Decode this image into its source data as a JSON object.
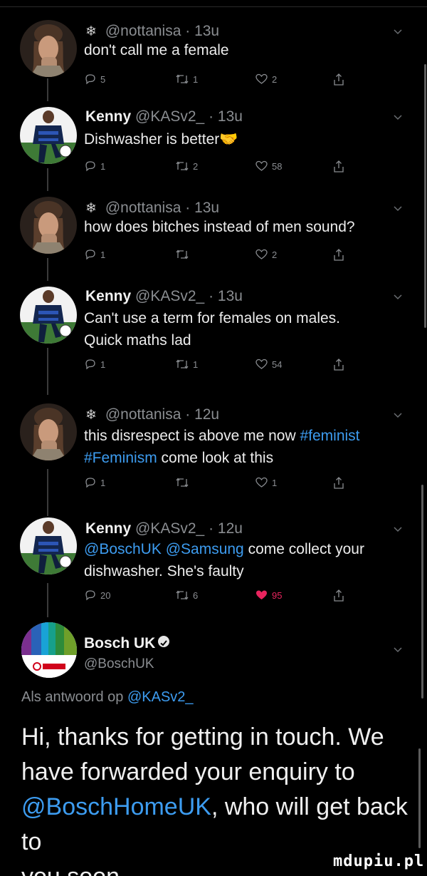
{
  "tweets": [
    {
      "user": "nottanisa",
      "name": "",
      "handle": "@nottanisa",
      "time": "13u",
      "body": [
        "don't call me a female"
      ],
      "replies": "5",
      "retweets": "1",
      "likes": "2",
      "liked": false
    },
    {
      "user": "kenny",
      "name": "Kenny",
      "handle": "@KASv2_",
      "time": "13u",
      "body": [
        "Dishwasher is better🤝"
      ],
      "replies": "1",
      "retweets": "2",
      "likes": "58",
      "liked": false
    },
    {
      "user": "nottanisa",
      "name": "",
      "handle": "@nottanisa",
      "time": "13u",
      "body": [
        "how does bitches instead of men sound?"
      ],
      "replies": "1",
      "retweets": "",
      "likes": "2",
      "liked": false
    },
    {
      "user": "kenny",
      "name": "Kenny",
      "handle": "@KASv2_",
      "time": "13u",
      "body": [
        "Can't use a term for females on males.",
        "Quick maths lad"
      ],
      "replies": "1",
      "retweets": "1",
      "likes": "54",
      "liked": false
    },
    {
      "user": "nottanisa",
      "name": "",
      "handle": "@nottanisa",
      "time": "12u",
      "body_parts": [
        {
          "text": "this disrespect is above me now ",
          "link": false
        },
        {
          "text": "#feminist",
          "link": true
        }
      ],
      "body_parts_2": [
        {
          "text": "#Feminism",
          "link": true
        },
        {
          "text": "  come look at this",
          "link": false
        }
      ],
      "replies": "1",
      "retweets": "",
      "likes": "1",
      "liked": false
    },
    {
      "user": "kenny",
      "name": "Kenny",
      "handle": "@KASv2_",
      "time": "12u",
      "body_parts": [
        {
          "text": "@BoschUK",
          "link": true
        },
        {
          "text": " ",
          "link": false
        },
        {
          "text": "@Samsung",
          "link": true
        },
        {
          "text": " come collect your",
          "link": false
        }
      ],
      "body_line2": "dishwasher. She's faulty",
      "replies": "20",
      "retweets": "6",
      "likes": "95",
      "liked": true
    }
  ],
  "bosch": {
    "name": "Bosch UK",
    "handle": "@BoschUK",
    "logo_text": "BOSCH",
    "reply_prefix": "Als antwoord op ",
    "reply_handle": "@KASv2_",
    "text_line1": "Hi, thanks for getting in touch. We",
    "text_line2": "have forwarded your enquiry to",
    "text_line3_link": "@BoschHomeUK",
    "text_line3_rest": ", who will get back to",
    "text_line4": "you soon."
  },
  "watermark": "mdupiu.pl",
  "colors": {
    "background": "#000000",
    "link": "#3d9cf0",
    "muted": "#8a8d91",
    "like_active": "#e8245e"
  },
  "icons": [
    "reply-icon",
    "retweet-icon",
    "heart-icon",
    "share-icon",
    "chevron-down-icon",
    "verified-icon"
  ]
}
